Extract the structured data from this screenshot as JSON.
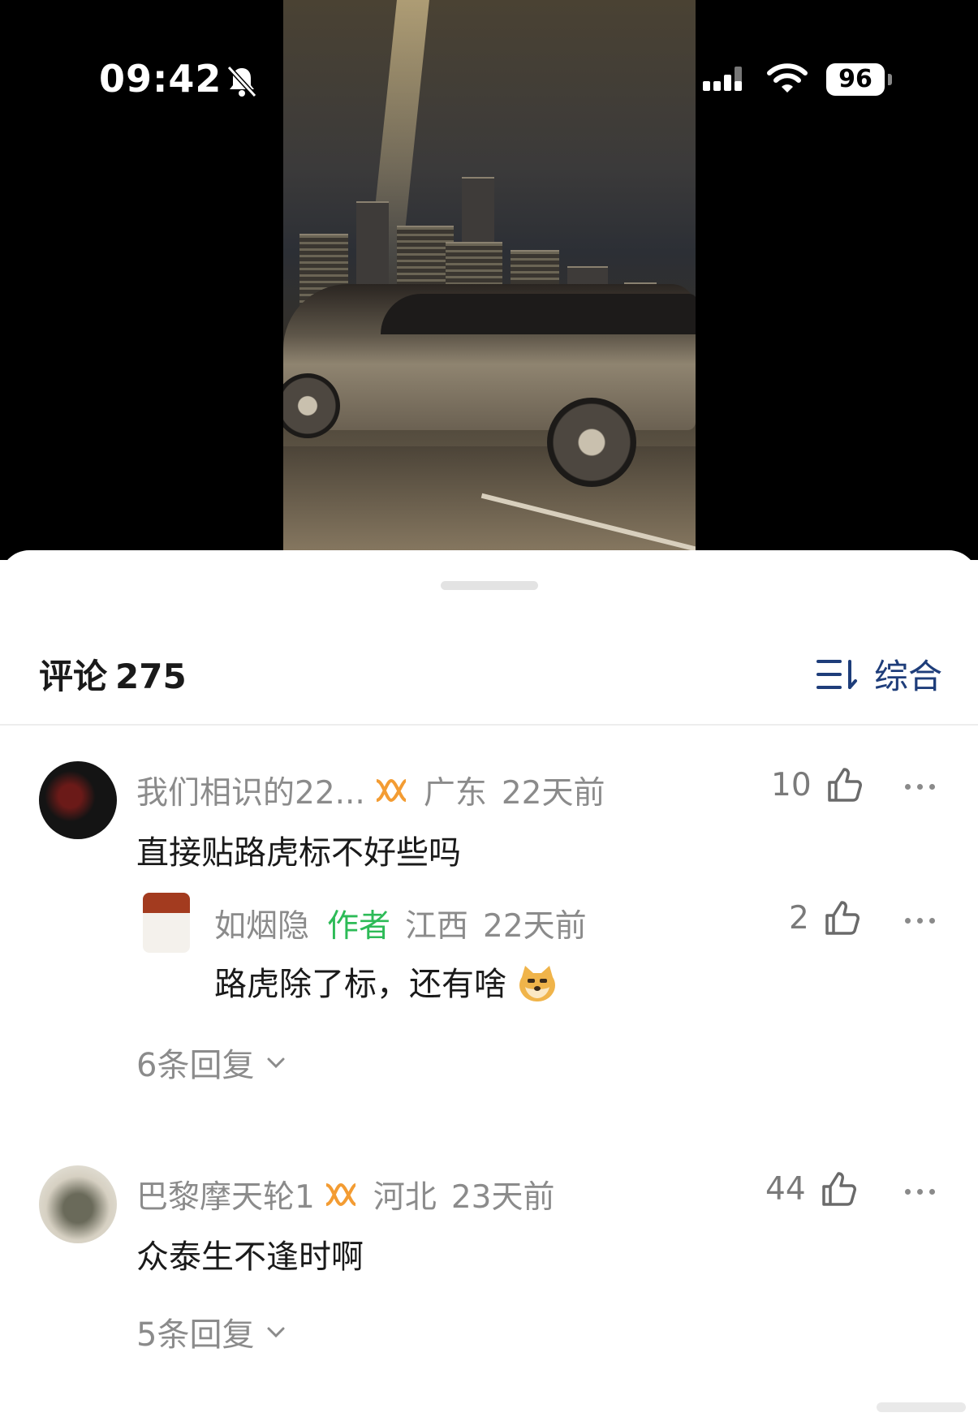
{
  "status_bar": {
    "time": "09:42",
    "battery": "96"
  },
  "comments_header": {
    "label": "评论",
    "count": "275",
    "sort_label": "综合"
  },
  "comments": [
    {
      "user": "我们相识的22...",
      "location": "广东",
      "time": "22天前",
      "likes": "10",
      "text": "直接贴路虎标不好些吗",
      "reply": {
        "user": "如烟隐",
        "tag": "作者",
        "location": "江西",
        "time": "22天前",
        "likes": "2",
        "text": "路虎除了标，还有啥"
      },
      "replies_label": "6条回复"
    },
    {
      "user": "巴黎摩天轮1",
      "location": "河北",
      "time": "23天前",
      "likes": "44",
      "text": "众泰生不逢时啊",
      "replies_label": "5条回复"
    }
  ],
  "colors": {
    "accent": "#1e3d7a",
    "author_tag": "#2dbb57",
    "vip_badge": "#f39c33"
  },
  "icons": [
    "bell-slash-icon",
    "signal-icon",
    "wifi-icon",
    "sort-icon",
    "vip-icon",
    "like-icon",
    "more-icon",
    "chevron-down-icon",
    "doge-emoji-icon"
  ]
}
